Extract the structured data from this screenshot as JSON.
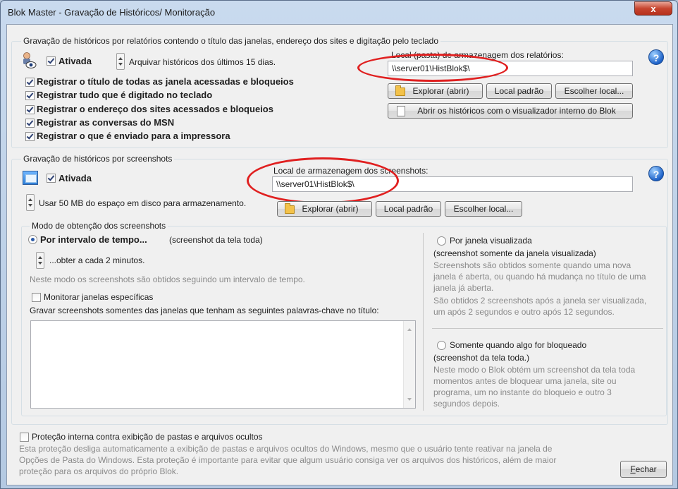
{
  "window": {
    "title": "Blok Master - Gravação de Históricos/ Monitoração",
    "close_label": "x"
  },
  "reports": {
    "group_title": "Gravação de históricos por relatórios contendo o título das janelas, endereço dos sites e digitação pelo teclado",
    "activated_label": "Ativada",
    "activated": true,
    "archive_text": "Arquivar históricos dos últimos 15 dias.",
    "options": [
      {
        "label": "Registrar o título de todas as janela acessadas e bloqueios",
        "checked": true
      },
      {
        "label": "Registrar tudo que é digitado no teclado",
        "checked": true
      },
      {
        "label": "Registrar o endereço dos sites acessados e bloqueios",
        "checked": true
      },
      {
        "label": "Registrar as conversas do MSN",
        "checked": true
      },
      {
        "label": "Registrar o que é enviado para a impressora",
        "checked": true
      }
    ],
    "location_label": "Local (pasta) de armazenagem dos relatórios:",
    "location_value": "\\\\server01\\HistBlok$\\",
    "explore_label": "Explorar (abrir)",
    "default_label": "Local padrão",
    "choose_label": "Escolher local...",
    "open_viewer_label": "Abrir os históricos com o visualizador interno do Blok",
    "help": "?"
  },
  "screenshots": {
    "group_title": "Gravação de históricos por screenshots",
    "activated_label": "Ativada",
    "activated": true,
    "disk_text": "Usar 50 MB do espaço em disco para armazenamento.",
    "location_label": "Local de armazenagem dos screenshots:",
    "location_value": "\\\\server01\\HistBlok$\\",
    "explore_label": "Explorar (abrir)",
    "default_label": "Local padrão",
    "choose_label": "Escolher local...",
    "help": "?",
    "mode": {
      "group_title": "Modo de obtenção dos screenshots",
      "interval_label": "Por intervalo de tempo...",
      "interval_note": "(screenshot da tela toda)",
      "interval_selected": true,
      "every_text": "...obter a cada 2 minutos.",
      "interval_desc": "Neste modo os screenshots são obtidos seguindo um intervalo de tempo.",
      "monitor_label": "Monitorar janelas específicas",
      "monitor_checked": false,
      "keywords_label": "Gravar screenshots somentes das janelas que tenham as seguintes palavras-chave no título:",
      "window_label": "Por janela visualizada",
      "window_note": "(screenshot somente da janela visualizada)",
      "window_desc_1": "Screenshots são obtidos somente quando uma nova",
      "window_desc_2": "janela é aberta, ou quando há mudança no título de uma",
      "window_desc_3": "janela já aberta.",
      "window_desc_4": "São obtidos 2 screenshots após a janela ser visualizada,",
      "window_desc_5": "um após 2 segundos e outro após 12 segundos.",
      "blocked_label": "Somente quando algo for bloqueado",
      "blocked_note": "(screenshot da tela toda.)",
      "blocked_desc_1": "Neste modo o Blok obtém um screenshot da tela toda",
      "blocked_desc_2": "momentos antes de bloquear uma janela, site ou",
      "blocked_desc_3": "programa, um no instante do bloqueio e outro 3",
      "blocked_desc_4": "segundos depois."
    }
  },
  "protection": {
    "label": "Proteção interna contra exibição de pastas e arquivos ocultos",
    "checked": false,
    "desc_1": "Esta proteção desliga automaticamente a exibição de pastas e arquivos ocultos do Windows, mesmo que o usuário tente reativar na janela de",
    "desc_2": "Opções de Pasta do Windows. Esta proteção é importante para evitar que algum usuário consiga ver os arquivos dos históricos, além de maior",
    "desc_3": "proteção para os arquivos do próprio Blok."
  },
  "close_button": {
    "first": "F",
    "rest": "echar"
  }
}
